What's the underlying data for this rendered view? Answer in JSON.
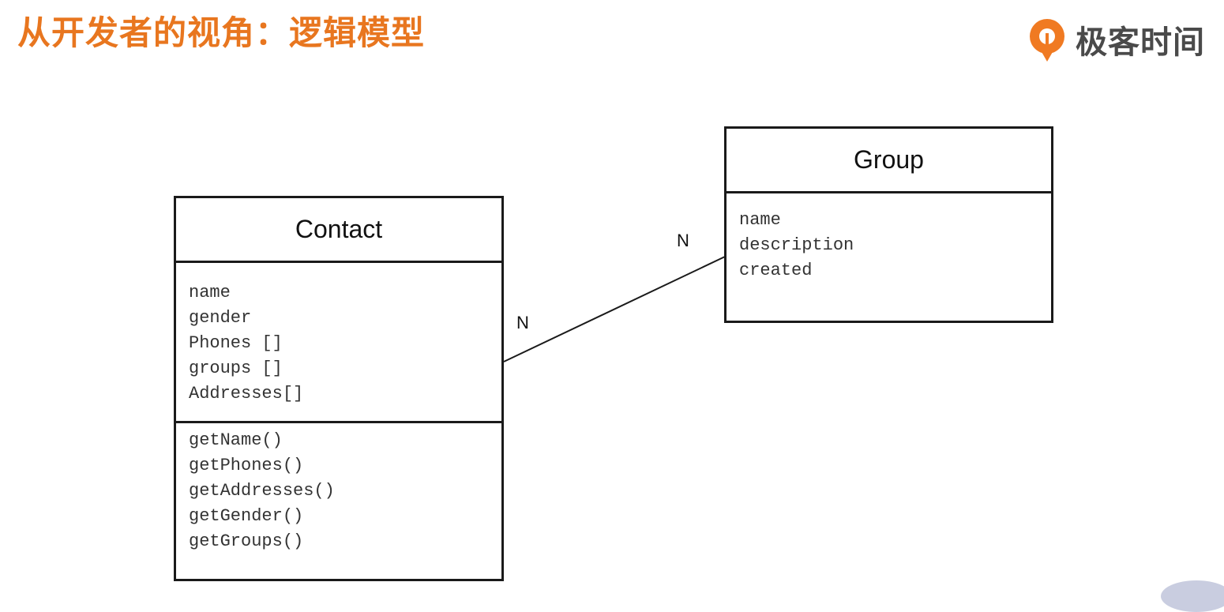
{
  "header": {
    "title": "从开发者的视角：逻辑模型",
    "logo_text": "极客时间"
  },
  "diagram": {
    "classes": [
      {
        "name": "Contact",
        "attributes": [
          "name",
          "gender",
          "Phones []",
          "groups []",
          "Addresses[]"
        ],
        "methods": [
          "getName()",
          "getPhones()",
          "getAddresses()",
          "getGender()",
          "getGroups()"
        ]
      },
      {
        "name": "Group",
        "attributes": [
          "name",
          "description",
          "created"
        ]
      }
    ],
    "association": {
      "contact_multiplicity": "N",
      "group_multiplicity": "N"
    }
  },
  "colors": {
    "title": "#e8761f",
    "logo_orange": "#f07a22",
    "line": "#1a1a1a"
  }
}
